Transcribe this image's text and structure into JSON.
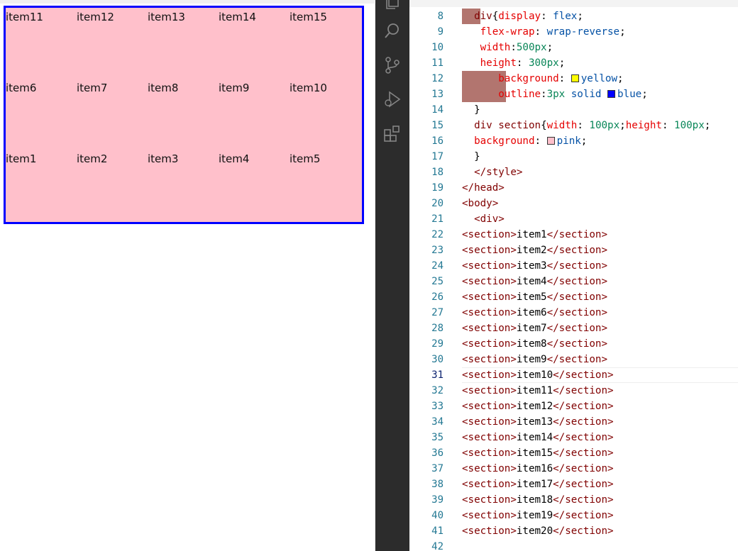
{
  "preview": {
    "rows": [
      [
        "item11",
        "item12",
        "item13",
        "item14",
        "item15"
      ],
      [
        "item6",
        "item7",
        "item8",
        "item9",
        "item10"
      ],
      [
        "item1",
        "item2",
        "item3",
        "item4",
        "item5"
      ]
    ],
    "box_background": "#ffc0cb",
    "box_outline": "#0000ff"
  },
  "activity_bar": {
    "icons": [
      "explorer-icon",
      "search-icon",
      "source-control-icon",
      "run-debug-icon",
      "extensions-icon"
    ]
  },
  "editor": {
    "active_line": "31",
    "lines": [
      {
        "num": "8",
        "segments": [
          [
            "  ",
            "t-txt"
          ],
          [
            "div",
            "t-sel"
          ],
          [
            "{",
            "t-punc"
          ],
          [
            "display",
            "t-prop"
          ],
          [
            ": ",
            "t-punc"
          ],
          [
            "flex",
            "t-val"
          ],
          [
            ";",
            "t-punc"
          ]
        ]
      },
      {
        "num": "9",
        "segments": [
          [
            "   ",
            "t-txt"
          ],
          [
            "flex-wrap",
            "t-prop"
          ],
          [
            ": ",
            "t-punc"
          ],
          [
            "wrap-reverse",
            "t-val"
          ],
          [
            ";",
            "t-punc"
          ]
        ]
      },
      {
        "num": "10",
        "segments": [
          [
            "   ",
            "t-txt"
          ],
          [
            "width",
            "t-prop"
          ],
          [
            ":",
            "t-punc"
          ],
          [
            "500px",
            "t-num"
          ],
          [
            ";",
            "t-punc"
          ]
        ]
      },
      {
        "num": "11",
        "segments": [
          [
            "   ",
            "t-txt"
          ],
          [
            "height",
            "t-prop"
          ],
          [
            ": ",
            "t-punc"
          ],
          [
            "300px",
            "t-num"
          ],
          [
            ";",
            "t-punc"
          ]
        ]
      },
      {
        "num": "12",
        "segments": [
          [
            "      ",
            "t-txt"
          ],
          [
            "background",
            "t-prop"
          ],
          [
            ": ",
            "t-punc"
          ],
          [
            "SWATCH:#ffff00",
            "sw"
          ],
          [
            "yellow",
            "t-val"
          ],
          [
            ";",
            "t-punc"
          ]
        ]
      },
      {
        "num": "13",
        "segments": [
          [
            "      ",
            "t-txt"
          ],
          [
            "outline",
            "t-prop"
          ],
          [
            ":",
            "t-punc"
          ],
          [
            "3px",
            "t-num"
          ],
          [
            " solid ",
            "t-val"
          ],
          [
            "SWATCH:#0000ff",
            "sw"
          ],
          [
            "blue",
            "t-val"
          ],
          [
            ";",
            "t-punc"
          ]
        ]
      },
      {
        "num": "14",
        "segments": [
          [
            "  ",
            "t-txt"
          ],
          [
            "}",
            "t-punc"
          ]
        ]
      },
      {
        "num": "15",
        "segments": [
          [
            "  ",
            "t-txt"
          ],
          [
            "div section",
            "t-sel"
          ],
          [
            "{",
            "t-punc"
          ],
          [
            "width",
            "t-prop"
          ],
          [
            ": ",
            "t-punc"
          ],
          [
            "100px",
            "t-num"
          ],
          [
            ";",
            "t-punc"
          ],
          [
            "height",
            "t-prop"
          ],
          [
            ": ",
            "t-punc"
          ],
          [
            "100px",
            "t-num"
          ],
          [
            ";",
            "t-punc"
          ]
        ]
      },
      {
        "num": "16",
        "segments": [
          [
            "  ",
            "t-txt"
          ],
          [
            "background",
            "t-prop"
          ],
          [
            ": ",
            "t-punc"
          ],
          [
            "SWATCH:#ffc0cb",
            "sw"
          ],
          [
            "pink",
            "t-val"
          ],
          [
            ";",
            "t-punc"
          ]
        ]
      },
      {
        "num": "17",
        "segments": [
          [
            "  ",
            "t-txt"
          ],
          [
            "}",
            "t-punc"
          ]
        ]
      },
      {
        "num": "18",
        "segments": [
          [
            "  ",
            "t-txt"
          ],
          [
            "</style>",
            "t-tag"
          ]
        ]
      },
      {
        "num": "19",
        "segments": [
          [
            "</head>",
            "t-tag"
          ]
        ]
      },
      {
        "num": "20",
        "segments": [
          [
            "<body>",
            "t-tag"
          ]
        ]
      },
      {
        "num": "21",
        "segments": [
          [
            "  ",
            "t-txt"
          ],
          [
            "<div>",
            "t-tag"
          ]
        ]
      },
      {
        "num": "22",
        "segments": [
          [
            "<section>",
            "t-tag"
          ],
          [
            "item1",
            "t-txt"
          ],
          [
            "</section>",
            "t-tag"
          ]
        ]
      },
      {
        "num": "23",
        "segments": [
          [
            "<section>",
            "t-tag"
          ],
          [
            "item2",
            "t-txt"
          ],
          [
            "</section>",
            "t-tag"
          ]
        ]
      },
      {
        "num": "24",
        "segments": [
          [
            "<section>",
            "t-tag"
          ],
          [
            "item3",
            "t-txt"
          ],
          [
            "</section>",
            "t-tag"
          ]
        ]
      },
      {
        "num": "25",
        "segments": [
          [
            "<section>",
            "t-tag"
          ],
          [
            "item4",
            "t-txt"
          ],
          [
            "</section>",
            "t-tag"
          ]
        ]
      },
      {
        "num": "26",
        "segments": [
          [
            "<section>",
            "t-tag"
          ],
          [
            "item5",
            "t-txt"
          ],
          [
            "</section>",
            "t-tag"
          ]
        ]
      },
      {
        "num": "27",
        "segments": [
          [
            "<section>",
            "t-tag"
          ],
          [
            "item6",
            "t-txt"
          ],
          [
            "</section>",
            "t-tag"
          ]
        ]
      },
      {
        "num": "28",
        "segments": [
          [
            "<section>",
            "t-tag"
          ],
          [
            "item7",
            "t-txt"
          ],
          [
            "</section>",
            "t-tag"
          ]
        ]
      },
      {
        "num": "29",
        "segments": [
          [
            "<section>",
            "t-tag"
          ],
          [
            "item8",
            "t-txt"
          ],
          [
            "</section>",
            "t-tag"
          ]
        ]
      },
      {
        "num": "30",
        "segments": [
          [
            "<section>",
            "t-tag"
          ],
          [
            "item9",
            "t-txt"
          ],
          [
            "</section>",
            "t-tag"
          ]
        ]
      },
      {
        "num": "31",
        "segments": [
          [
            "<section>",
            "t-tag"
          ],
          [
            "item10",
            "t-txt"
          ],
          [
            "</section>",
            "t-tag"
          ]
        ]
      },
      {
        "num": "32",
        "segments": [
          [
            "<section>",
            "t-tag"
          ],
          [
            "item11",
            "t-txt"
          ],
          [
            "</section>",
            "t-tag"
          ]
        ]
      },
      {
        "num": "33",
        "segments": [
          [
            "<section>",
            "t-tag"
          ],
          [
            "item12",
            "t-txt"
          ],
          [
            "</section>",
            "t-tag"
          ]
        ]
      },
      {
        "num": "34",
        "segments": [
          [
            "<section>",
            "t-tag"
          ],
          [
            "item13",
            "t-txt"
          ],
          [
            "</section>",
            "t-tag"
          ]
        ]
      },
      {
        "num": "35",
        "segments": [
          [
            "<section>",
            "t-tag"
          ],
          [
            "item14",
            "t-txt"
          ],
          [
            "</section>",
            "t-tag"
          ]
        ]
      },
      {
        "num": "36",
        "segments": [
          [
            "<section>",
            "t-tag"
          ],
          [
            "item15",
            "t-txt"
          ],
          [
            "</section>",
            "t-tag"
          ]
        ]
      },
      {
        "num": "37",
        "segments": [
          [
            "<section>",
            "t-tag"
          ],
          [
            "item16",
            "t-txt"
          ],
          [
            "</section>",
            "t-tag"
          ]
        ]
      },
      {
        "num": "38",
        "segments": [
          [
            "<section>",
            "t-tag"
          ],
          [
            "item17",
            "t-txt"
          ],
          [
            "</section>",
            "t-tag"
          ]
        ]
      },
      {
        "num": "39",
        "segments": [
          [
            "<section>",
            "t-tag"
          ],
          [
            "item18",
            "t-txt"
          ],
          [
            "</section>",
            "t-tag"
          ]
        ]
      },
      {
        "num": "40",
        "segments": [
          [
            "<section>",
            "t-tag"
          ],
          [
            "item19",
            "t-txt"
          ],
          [
            "</section>",
            "t-tag"
          ]
        ]
      },
      {
        "num": "41",
        "segments": [
          [
            "<section>",
            "t-tag"
          ],
          [
            "item20",
            "t-txt"
          ],
          [
            "</section>",
            "t-tag"
          ]
        ]
      },
      {
        "num": "42",
        "segments": []
      }
    ]
  }
}
